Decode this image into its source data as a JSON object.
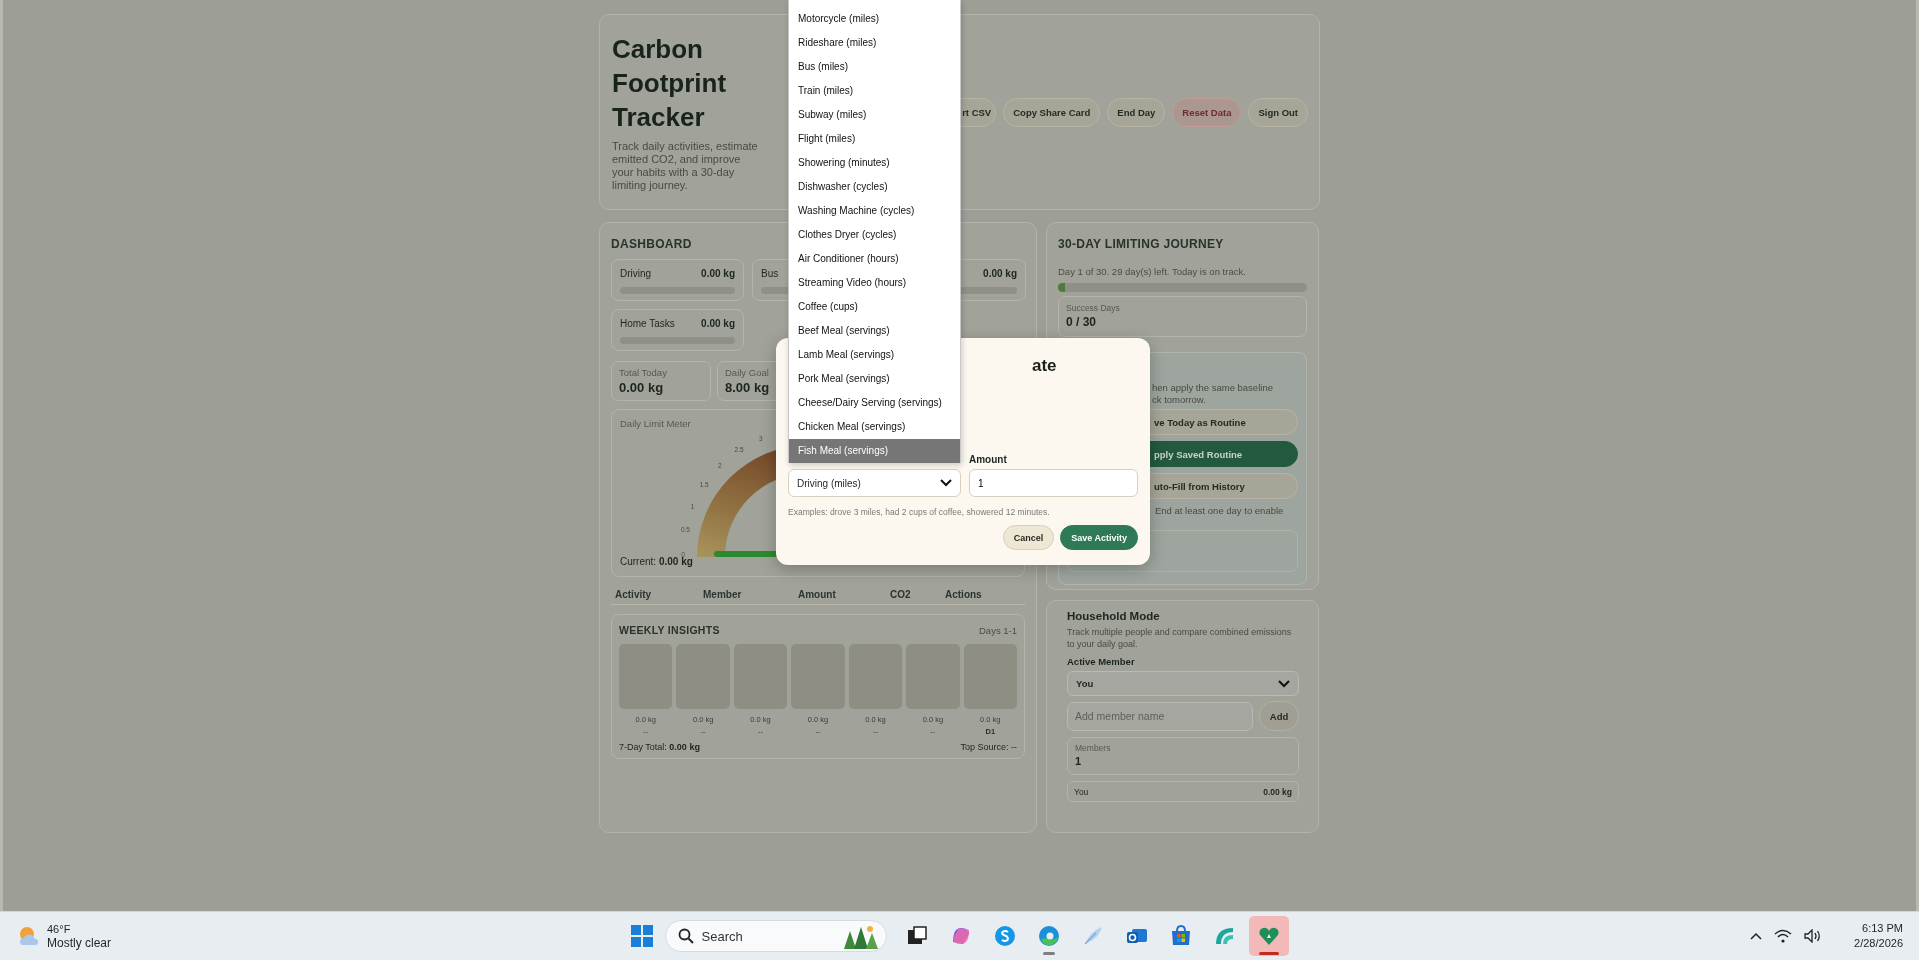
{
  "header": {
    "title": "Carbon Footprint Tracker",
    "description": "Track daily activities, estimate emitted CO2, and improve your habits with a 30-day limiting journey.",
    "buttons": [
      {
        "label": "rt CSV",
        "kind": "plain"
      },
      {
        "label": "Copy Share Card",
        "kind": "plain"
      },
      {
        "label": "End Day",
        "kind": "plain"
      },
      {
        "label": "Reset Data",
        "kind": "danger"
      },
      {
        "label": "Sign Out",
        "kind": "plain"
      }
    ]
  },
  "dashboard": {
    "title": "DASHBOARD",
    "categories": [
      {
        "label": "Driving",
        "value": "0.00 kg"
      },
      {
        "label": "Bus"
      },
      {
        "value": "0.00 kg"
      },
      {
        "label": "Home Tasks",
        "value": "0.00 kg"
      }
    ],
    "stats": [
      {
        "label": "Total Today",
        "value": "0.00 kg"
      },
      {
        "label": "Daily Goal",
        "value": "8.00 kg"
      }
    ],
    "meter": {
      "title": "Daily Limit Meter",
      "ticks": [
        "0",
        "0.5",
        "1",
        "1.5",
        "2",
        "2.5",
        "3"
      ],
      "current": "Current: **0.00 kg**"
    },
    "table": {
      "columns": [
        "Activity",
        "Member",
        "Amount",
        "CO2",
        "Actions"
      ]
    },
    "weekly": {
      "title": "WEEKLY INSIGHTS",
      "range": "Days 1-1",
      "days": [
        {
          "value": "0.0 kg",
          "label": "--",
          "current": false
        },
        {
          "value": "0.0 kg",
          "label": "--",
          "current": false
        },
        {
          "value": "0.0 kg",
          "label": "--",
          "current": false
        },
        {
          "value": "0.0 kg",
          "label": "--",
          "current": false
        },
        {
          "value": "0.0 kg",
          "label": "--",
          "current": false
        },
        {
          "value": "0.0 kg",
          "label": "--",
          "current": false
        },
        {
          "value": "0.0 kg",
          "label": "D1",
          "current": true
        }
      ],
      "total": "7-Day Total: **0.00 kg**",
      "top_source": "Top Source: --"
    }
  },
  "journey": {
    "title": "30-DAY LIMITING JOURNEY",
    "status": "Day 1 of 30. 29 day(s) left. Today is on track.",
    "level": 0.03,
    "success_label": "Success Days",
    "success_value": "0 / 30",
    "routine": {
      "description_lines": [
        "hen apply the same baseline",
        "ck tomorrow."
      ],
      "buttons": [
        {
          "label": "ve Today as Routine",
          "kind": "plain"
        },
        {
          "label": "pply Saved Routine",
          "kind": "primary"
        },
        {
          "label": "uto-Fill from History",
          "kind": "plain"
        }
      ],
      "note": "End at least one day to enable"
    }
  },
  "household": {
    "title": "Household Mode",
    "description": "Track multiple people and compare combined emissions to your daily goal.",
    "active_label": "Active Member",
    "active_value": "You",
    "add_placeholder": "Add member name",
    "add_button": "Add",
    "members_label": "Members",
    "members_value": "1",
    "members": [
      {
        "name": "You",
        "value": "0.00 kg"
      }
    ]
  },
  "modal": {
    "title": "ate",
    "amount_label": "Amount",
    "activity_value": "Driving (miles)",
    "amount_value": "1",
    "hint": "Examples: drove 3 miles, had 2 cups of coffee, showered 12 minutes.",
    "buttons": [
      {
        "label": "Cancel",
        "kind": "secondary"
      },
      {
        "label": "Save Activity",
        "kind": "primary"
      }
    ]
  },
  "dropdown": {
    "options": [
      {
        "label": "Motorcycle (miles)",
        "selected": false
      },
      {
        "label": "Rideshare (miles)",
        "selected": false
      },
      {
        "label": "Bus (miles)",
        "selected": false
      },
      {
        "label": "Train (miles)",
        "selected": false
      },
      {
        "label": "Subway (miles)",
        "selected": false
      },
      {
        "label": "Flight (miles)",
        "selected": false
      },
      {
        "label": "Showering (minutes)",
        "selected": false
      },
      {
        "label": "Dishwasher (cycles)",
        "selected": false
      },
      {
        "label": "Washing Machine (cycles)",
        "selected": false
      },
      {
        "label": "Clothes Dryer (cycles)",
        "selected": false
      },
      {
        "label": "Air Conditioner (hours)",
        "selected": false
      },
      {
        "label": "Streaming Video (hours)",
        "selected": false
      },
      {
        "label": "Coffee (cups)",
        "selected": false
      },
      {
        "label": "Beef Meal (servings)",
        "selected": false
      },
      {
        "label": "Lamb Meal (servings)",
        "selected": false
      },
      {
        "label": "Pork Meal (servings)",
        "selected": false
      },
      {
        "label": "Cheese/Dairy Serving (servings)",
        "selected": false
      },
      {
        "label": "Chicken Meal (servings)",
        "selected": false
      },
      {
        "label": "Fish Meal (servings)",
        "selected": true
      }
    ]
  },
  "taskbar": {
    "weather": {
      "temperature": "46°F",
      "condition": "Mostly clear"
    },
    "search_placeholder": "Search",
    "apps": [
      {
        "kind": "taskview",
        "open": false,
        "focused": false
      },
      {
        "kind": "copilot",
        "open": false,
        "focused": false
      },
      {
        "kind": "skype",
        "open": false,
        "focused": false
      },
      {
        "kind": "browser",
        "open": true,
        "focused": false
      },
      {
        "kind": "feather",
        "open": false,
        "focused": false
      },
      {
        "kind": "mail",
        "open": false,
        "focused": false
      },
      {
        "kind": "store",
        "open": false,
        "focused": false
      },
      {
        "kind": "wave",
        "open": false,
        "focused": false
      },
      {
        "kind": "heart",
        "open": true,
        "focused": true
      }
    ],
    "time": "6:13 PM",
    "date": "2/28/2026"
  }
}
